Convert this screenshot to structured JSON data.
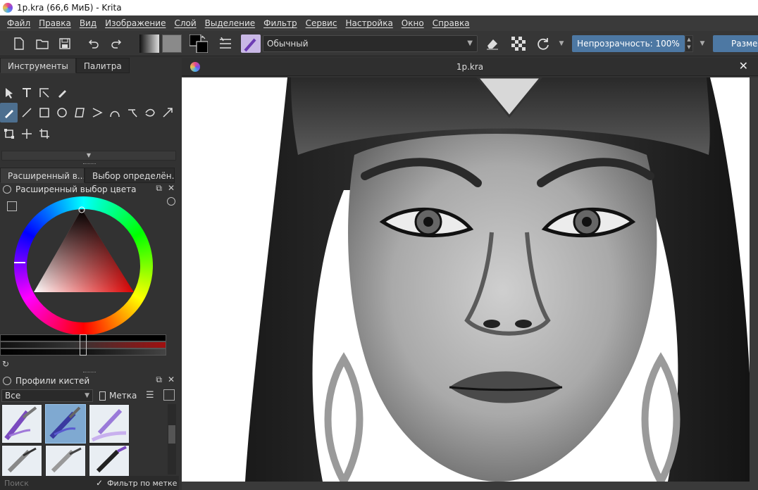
{
  "window": {
    "title": "1p.kra (66,6 МиБ)  -  Krita"
  },
  "menu": [
    "Файл",
    "Правка",
    "Вид",
    "Изображение",
    "Слой",
    "Выделение",
    "Фильтр",
    "Сервис",
    "Настройка",
    "Окно",
    "Справка"
  ],
  "toolbar": {
    "blend_mode": "Обычный",
    "opacity_label": "Непрозрачность: 100%",
    "size_label": "Размер"
  },
  "left_tabs": [
    "Инструменты",
    "Палитра"
  ],
  "color_docker": {
    "tabs": [
      "Расширенный в...",
      "Выбор определён..."
    ],
    "title": "Расширенный выбор цвета"
  },
  "brush_docker": {
    "title": "Профили кистей",
    "filter_value": "Все",
    "tag_label": "Метка",
    "search_placeholder": "Поиск",
    "filter_by_tag": "Фильтр по метке"
  },
  "document": {
    "tab_title": "1p.kra"
  },
  "colors": {
    "accent": "#4d78a3",
    "panel": "#323232",
    "menubar": "#3a3a3a"
  }
}
